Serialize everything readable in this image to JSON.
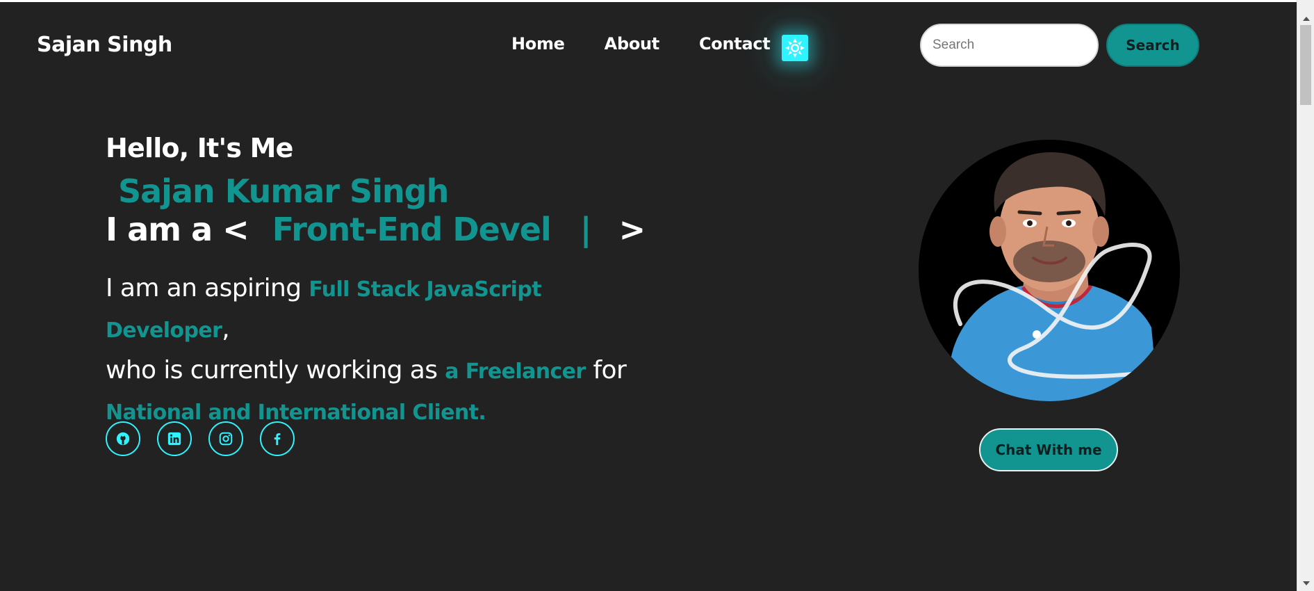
{
  "header": {
    "brand": "Sajan Singh",
    "nav": [
      "Home",
      "About",
      "Contact"
    ],
    "theme_toggle_icon": "sun-icon",
    "search_placeholder": "Search",
    "search_button": "Search"
  },
  "hero": {
    "greeting": "Hello, It's Me",
    "name": "Sajan Kumar Singh",
    "typing_prefix": "I am a <",
    "typing_role": "Front-End Devel",
    "typing_cursor": "|",
    "typing_suffix": ">",
    "desc_1": "I am an aspiring ",
    "desc_hl_1": "Full Stack JavaScript Developer",
    "desc_2": ",",
    "desc_3": "who is currently working as ",
    "desc_hl_2": "a Freelancer",
    "desc_4": " for",
    "desc_hl_3": "National and International Client.",
    "socials": [
      "github-icon",
      "linkedin-icon",
      "instagram-icon",
      "facebook-icon"
    ]
  },
  "profile": {
    "chat_button": "Chat With me"
  },
  "colors": {
    "background": "#222222",
    "accent": "#129591",
    "glow": "#2ff4ff"
  }
}
